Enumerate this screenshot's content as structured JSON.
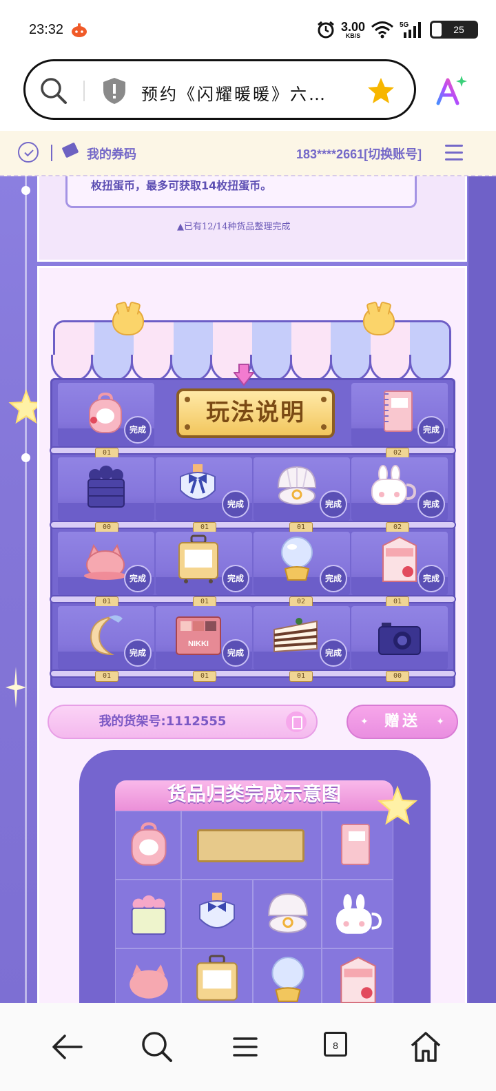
{
  "status_bar": {
    "time": "23:32",
    "speed": "3.00",
    "speed_unit": "KB/S",
    "network": "5G",
    "battery": "25"
  },
  "browser": {
    "url_text": "预约《闪耀暖暖》六…",
    "icons": [
      "search-icon",
      "shield-icon",
      "star-icon",
      "ai-assistant-icon"
    ]
  },
  "site_header": {
    "my_codes": "我的券码",
    "account": "183****2661[切换账号]"
  },
  "page": {
    "rule_text": "枚扭蛋币，最多可获取14枚扭蛋币。",
    "progress_text": "▲已有12/14种货品整理完成",
    "help_button": "玩法说明",
    "shelf_id_label": "我的货架号:1112555",
    "gift_button": "赠送",
    "diagram_title": "货品归类完成示意图",
    "done_label": "完成"
  },
  "shelf": {
    "rows": [
      {
        "items": [
          {
            "name": "bunny-backpack",
            "count": "01",
            "done": true
          },
          {
            "name": "help",
            "count": "",
            "done": false
          },
          {
            "name": "photo-album",
            "count": "02",
            "done": true
          }
        ]
      },
      {
        "items": [
          {
            "name": "flower-basket",
            "count": "00",
            "done": false
          },
          {
            "name": "bow-perfume",
            "count": "01",
            "done": true
          },
          {
            "name": "shell-ring",
            "count": "01",
            "done": true
          },
          {
            "name": "bunny-mug",
            "count": "02",
            "done": true
          }
        ]
      },
      {
        "items": [
          {
            "name": "cat-beret",
            "count": "01",
            "done": true
          },
          {
            "name": "suitcase",
            "count": "01",
            "done": true
          },
          {
            "name": "crystal-ball",
            "count": "02",
            "done": true
          },
          {
            "name": "milk-carton",
            "count": "01",
            "done": true
          }
        ]
      },
      {
        "items": [
          {
            "name": "moon-pillow",
            "count": "01",
            "done": true
          },
          {
            "name": "nikki-palette",
            "count": "01",
            "done": true
          },
          {
            "name": "layer-cake",
            "count": "01",
            "done": true
          },
          {
            "name": "camera",
            "count": "00",
            "done": false
          }
        ]
      }
    ],
    "palette_brand": "NIKKI"
  },
  "bottom_nav": {
    "tab_count": "8",
    "icons": [
      "back-arrow-icon",
      "search-icon",
      "menu-icon",
      "tabs-icon",
      "home-icon"
    ]
  },
  "colors": {
    "purple_main": "#7d6fd3",
    "purple_dark": "#6052bb",
    "pink": "#f4b9ee",
    "gold": "#f2c65d"
  }
}
